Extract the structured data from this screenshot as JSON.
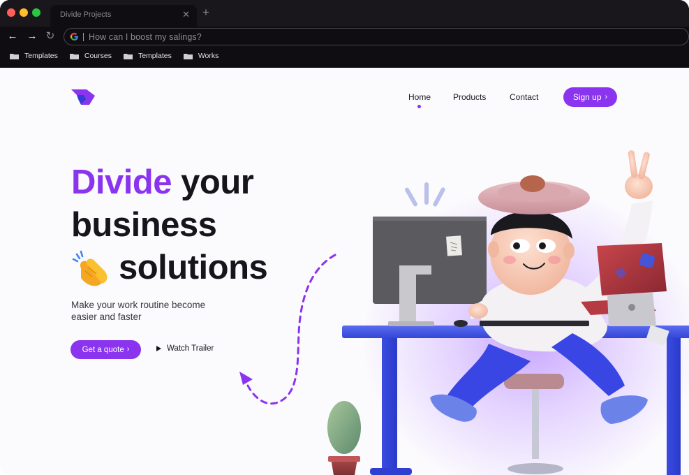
{
  "browser": {
    "tab_title": "Divide Projects",
    "close_glyph": "✕",
    "new_tab_glyph": "+",
    "back_glyph": "←",
    "forward_glyph": "→",
    "reload_glyph": "↻",
    "omnibox_text": "How can I boost my salings?",
    "traffic_lights": [
      "#fe5f57",
      "#febc2e",
      "#28c840"
    ],
    "bookmarks": [
      "Templates",
      "Courses",
      "Templates",
      "Works"
    ]
  },
  "nav": {
    "items": [
      "Home",
      "Products",
      "Contact"
    ],
    "active": "Home",
    "signup_label": "Sign up",
    "chevron": "›"
  },
  "hero": {
    "accent_word": "Divide",
    "line1_rest": " your",
    "line2": "business",
    "line3": "solutions",
    "subtitle": "Make your work routine become easier and faster",
    "quote_label": "Get a quote",
    "trailer_label": "Watch Trailer"
  },
  "colors": {
    "accent": "#8b34ef",
    "text": "#16151b",
    "chrome_bg": "#0f0d12"
  },
  "icons": [
    "google-icon",
    "folder-icon",
    "logo-icon",
    "clap-icon",
    "play-icon",
    "chevron-right-icon"
  ]
}
